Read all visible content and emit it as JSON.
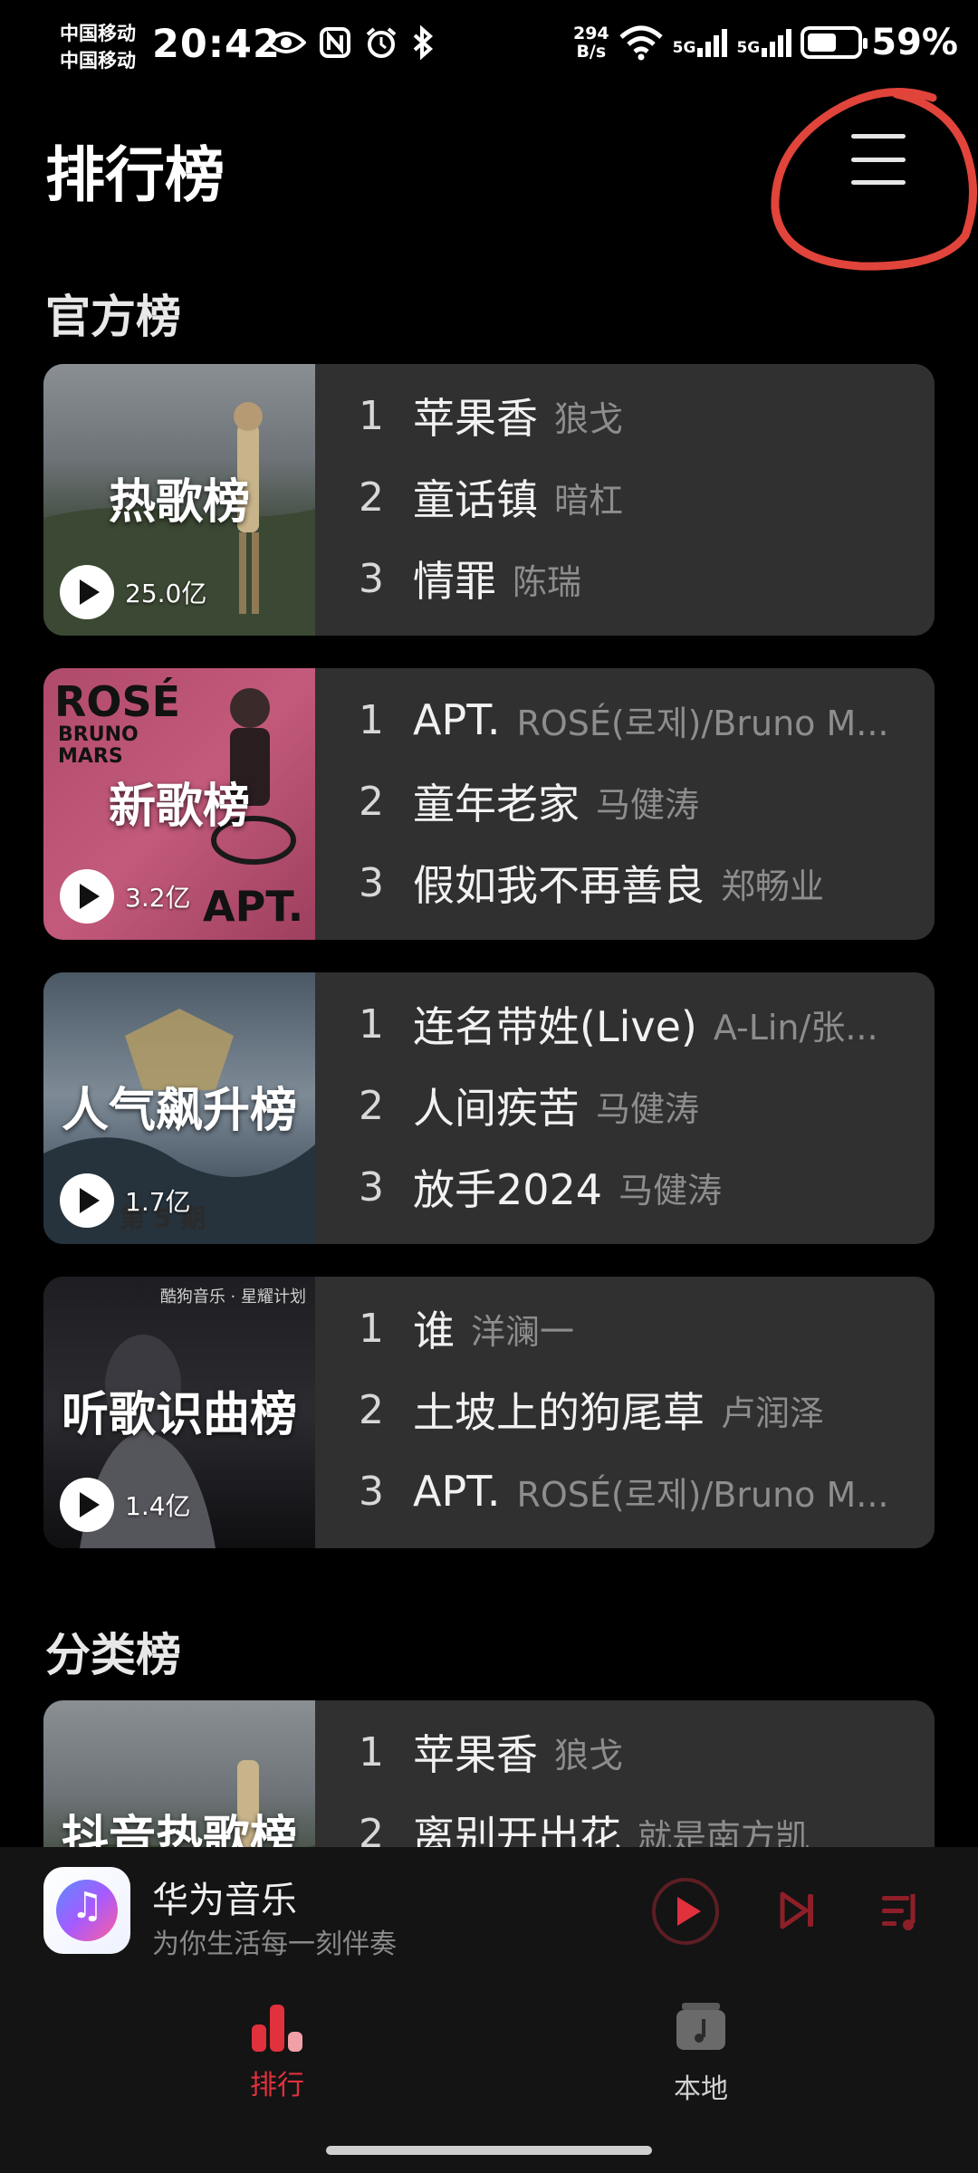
{
  "status_bar": {
    "carrier_1": "中国移动",
    "carrier_2": "中国移动",
    "time": "20:42",
    "net_speed_value": "294",
    "net_speed_unit": "B/s",
    "sim1_label": "5G",
    "sim2_label": "5G",
    "battery_percent": "59%",
    "battery_level": 0.59
  },
  "header": {
    "title": "排行榜",
    "menu_icon": "hamburger-menu-icon"
  },
  "sections": {
    "official": "官方榜",
    "category": "分类榜"
  },
  "charts": [
    {
      "name": "热歌榜",
      "plays": "25.0亿",
      "songs": [
        {
          "rank": "1",
          "title": "苹果香",
          "artist": "狼戈"
        },
        {
          "rank": "2",
          "title": "童话镇",
          "artist": "暗杠"
        },
        {
          "rank": "3",
          "title": "情罪",
          "artist": "陈瑞"
        }
      ]
    },
    {
      "name": "新歌榜",
      "plays": "3.2亿",
      "cover_text_1": "ROSÉ",
      "cover_text_2": "BRUNO MARS",
      "cover_text_3": "APT.",
      "songs": [
        {
          "rank": "1",
          "title": "APT.",
          "artist": "ROSÉ(로제)/Bruno M..."
        },
        {
          "rank": "2",
          "title": "童年老家",
          "artist": "马健涛"
        },
        {
          "rank": "3",
          "title": "假如我不再善良",
          "artist": "郑畅业"
        }
      ]
    },
    {
      "name": "人气飙升榜",
      "plays": "1.7亿",
      "cover_text_1": "第 5 期",
      "songs": [
        {
          "rank": "1",
          "title": "连名带姓(Live)",
          "artist": "A-Lin/张..."
        },
        {
          "rank": "2",
          "title": "人间疾苦",
          "artist": "马健涛"
        },
        {
          "rank": "3",
          "title": "放手2024",
          "artist": "马健涛"
        }
      ]
    },
    {
      "name": "听歌识曲榜",
      "plays": "1.4亿",
      "cover_text_1": "酷狗音乐 · 星耀计划",
      "songs": [
        {
          "rank": "1",
          "title": "谁",
          "artist": "洋澜一"
        },
        {
          "rank": "2",
          "title": "土坡上的狗尾草",
          "artist": "卢润泽"
        },
        {
          "rank": "3",
          "title": "APT.",
          "artist": "ROSÉ(로제)/Bruno M..."
        }
      ]
    },
    {
      "name": "抖音热歌榜",
      "songs": [
        {
          "rank": "1",
          "title": "苹果香",
          "artist": "狼戈"
        },
        {
          "rank": "2",
          "title": "离别开出花",
          "artist": "就是南方凯"
        }
      ]
    }
  ],
  "mini_player": {
    "title": "华为音乐",
    "subtitle": "为你生活每一刻伴奏"
  },
  "bottom_nav": [
    {
      "label": "排行",
      "active": true
    },
    {
      "label": "本地",
      "active": false
    }
  ],
  "colors": {
    "accent": "#e0313d",
    "card": "#303030",
    "background": "#000000",
    "annotation": "#e0443a"
  }
}
